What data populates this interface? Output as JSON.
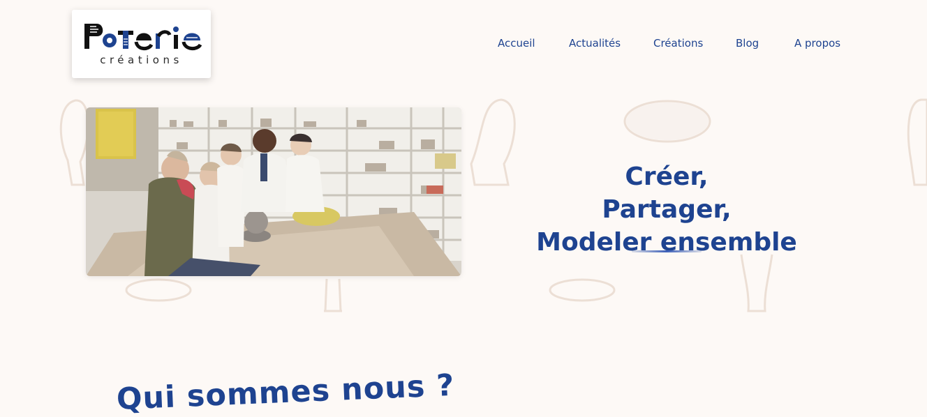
{
  "header": {
    "logo": {
      "wordmark": "PoTerie",
      "subtitle": "créations"
    },
    "nav": [
      {
        "label": "Accueil"
      },
      {
        "label": "Actualités"
      },
      {
        "label": "Créations"
      },
      {
        "label": "Blog"
      },
      {
        "label": "A propos"
      }
    ]
  },
  "hero": {
    "title_lines": [
      "Créer,",
      "Partager,",
      "Modeler ensemble"
    ],
    "photo": {
      "subject": "group of people smiling around a pottery workshop table"
    }
  },
  "about": {
    "title": "Qui sommes nous ?"
  },
  "colors": {
    "background": "#fdf9f6",
    "primary": "#1e4390",
    "decoration": "#ede0d6"
  },
  "icons": {
    "background_shapes": "pottery-tool-outline-decoration"
  }
}
